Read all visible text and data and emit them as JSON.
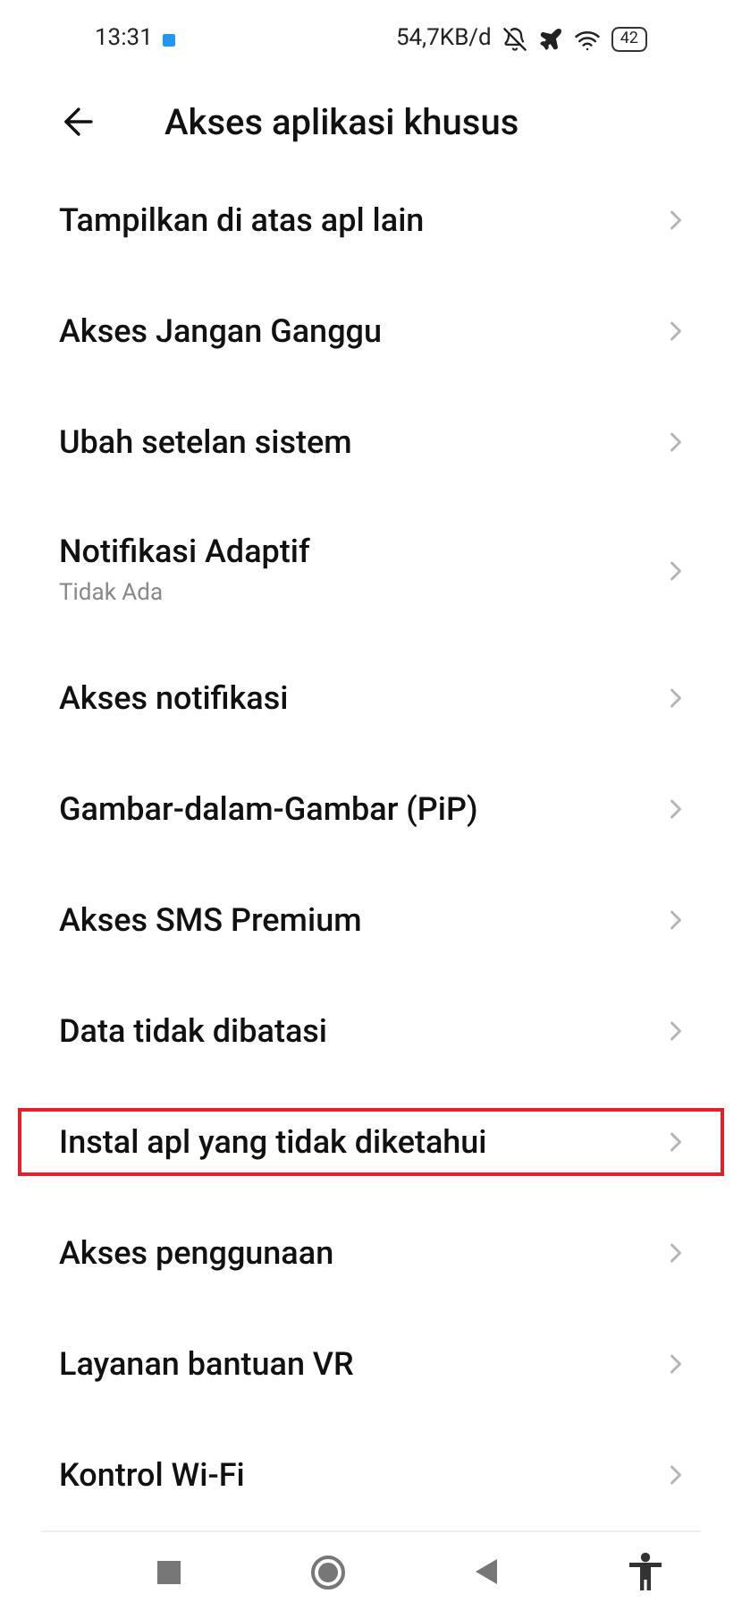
{
  "status_bar": {
    "time": "13:31",
    "speed": "54,7KB/d",
    "battery": "42"
  },
  "header": {
    "title": "Akses aplikasi khusus"
  },
  "items": [
    {
      "label": "Tampilkan di atas apl lain",
      "highlighted": false
    },
    {
      "label": "Akses Jangan Ganggu",
      "highlighted": false
    },
    {
      "label": "Ubah setelan sistem",
      "highlighted": false
    },
    {
      "label": "Notifikasi Adaptif",
      "subtitle": "Tidak Ada",
      "highlighted": false
    },
    {
      "label": "Akses notifikasi",
      "highlighted": false
    },
    {
      "label": "Gambar-dalam-Gambar (PiP)",
      "highlighted": false
    },
    {
      "label": "Akses SMS Premium",
      "highlighted": false
    },
    {
      "label": "Data tidak dibatasi",
      "highlighted": false
    },
    {
      "label": "Instal apl yang tidak diketahui",
      "highlighted": true
    },
    {
      "label": "Akses penggunaan",
      "highlighted": false
    },
    {
      "label": "Layanan bantuan VR",
      "highlighted": false
    },
    {
      "label": "Kontrol Wi-Fi",
      "highlighted": false
    }
  ]
}
